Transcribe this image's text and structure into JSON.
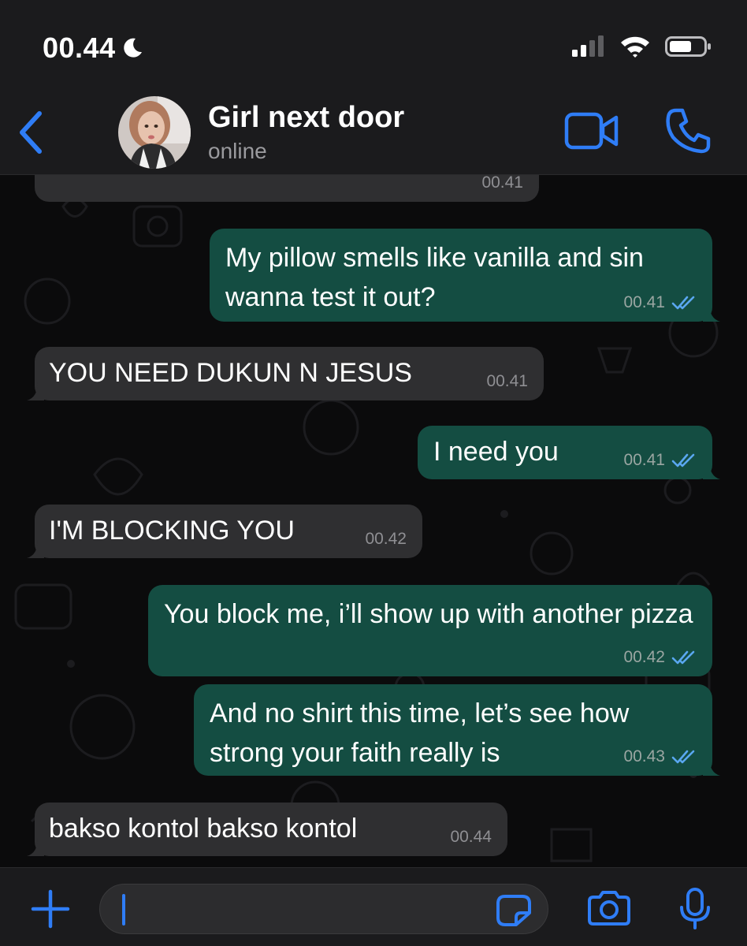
{
  "status_bar": {
    "time": "00.44"
  },
  "header": {
    "contact_name": "Girl next door",
    "contact_status": "online"
  },
  "messages": [
    {
      "direction": "in",
      "text": "",
      "time": "00.41"
    },
    {
      "direction": "out",
      "text": "My pillow smells like vanilla and sin wanna test it out?",
      "time": "00.41",
      "read": true
    },
    {
      "direction": "in",
      "text": "YOU NEED DUKUN N JESUS",
      "time": "00.41"
    },
    {
      "direction": "out",
      "text": "I need you",
      "time": "00.41",
      "read": true
    },
    {
      "direction": "in",
      "text": "I'M BLOCKING YOU",
      "time": "00.42"
    },
    {
      "direction": "out",
      "text": "You block me, i’ll show up with another pizza",
      "time": "00.42",
      "read": true
    },
    {
      "direction": "out",
      "text": "And no shirt this time, let’s see how strong your faith really is",
      "time": "00.43",
      "read": true
    },
    {
      "direction": "in",
      "text": "bakso kontol bakso kontol",
      "time": "00.44"
    }
  ],
  "input": {
    "value": ""
  },
  "colors": {
    "accent": "#2f7df6",
    "incoming_bubble": "#2f2f31",
    "outgoing_bubble": "#144d42",
    "chat_background": "#0b0b0c",
    "bar_background": "#1b1b1d",
    "read_ticks": "#5aa7f0"
  },
  "icons": [
    "moon-icon",
    "signal-icon",
    "wifi-icon",
    "battery-icon",
    "back-chevron-icon",
    "video-call-icon",
    "phone-icon",
    "plus-icon",
    "sticker-icon",
    "camera-icon",
    "microphone-icon",
    "double-check-icon"
  ]
}
